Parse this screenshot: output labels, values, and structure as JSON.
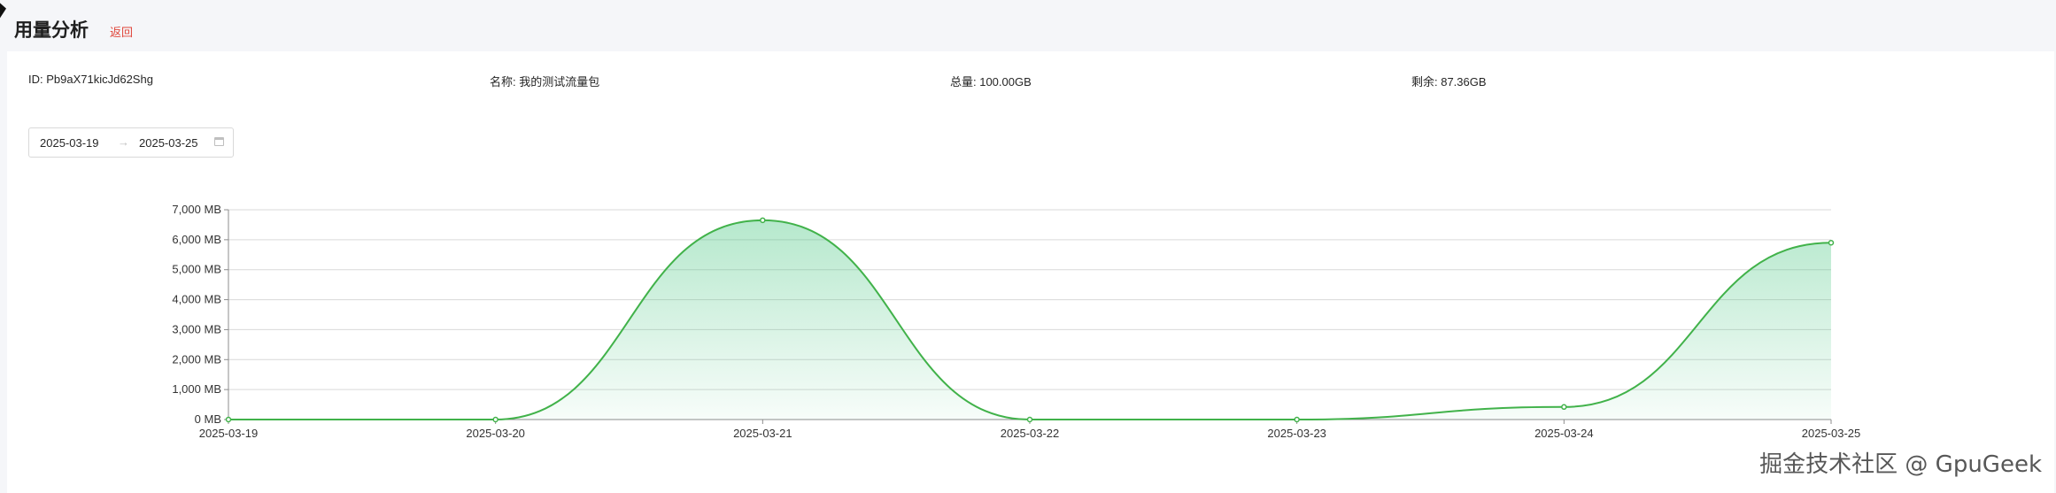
{
  "header": {
    "title": "用量分析",
    "back_label": "返回"
  },
  "info": {
    "id": "ID: Pb9aX71kicJd62Shg",
    "name": "名称: 我的测试流量包",
    "total": "总量: 100.00GB",
    "remaining": "剩余: 87.36GB"
  },
  "date_range": {
    "start": "2025-03-19",
    "separator": "→",
    "end": "2025-03-25"
  },
  "chart_data": {
    "type": "area",
    "x": [
      "2025-03-19",
      "2025-03-20",
      "2025-03-21",
      "2025-03-22",
      "2025-03-23",
      "2025-03-24",
      "2025-03-25"
    ],
    "y_ticks": [
      "0 MB",
      "1,000 MB",
      "2,000 MB",
      "3,000 MB",
      "4,000 MB",
      "5,000 MB",
      "6,000 MB",
      "7,000 MB"
    ],
    "values": [
      0,
      0,
      6650,
      0,
      0,
      420,
      5900
    ],
    "ylim": [
      0,
      7000
    ],
    "grid": true,
    "line_color": "#41b24a",
    "fill_color": "#3ec37a"
  },
  "watermark": "掘金技术社区 @ GpuGeek"
}
